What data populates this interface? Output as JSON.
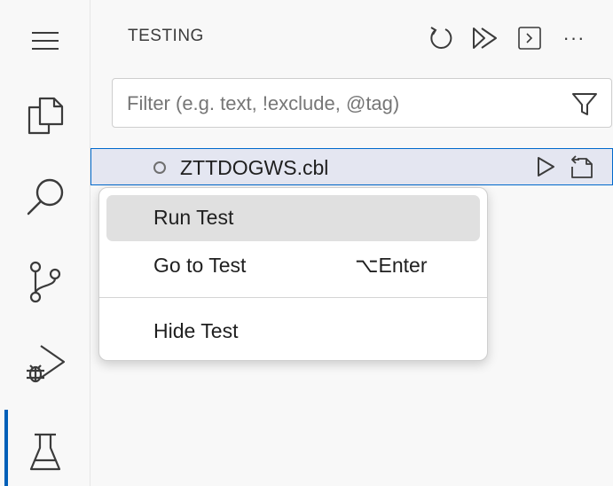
{
  "activity_bar": {
    "icons": [
      "menu-icon",
      "explorer-icon",
      "search-icon",
      "source-control-icon",
      "run-debug-icon",
      "testing-icon"
    ],
    "active": "testing-icon"
  },
  "sidebar": {
    "title": "TESTING",
    "header_actions": [
      "refresh-icon",
      "run-all-icon",
      "terminal-icon",
      "more-icon"
    ],
    "more_label": "···",
    "filter": {
      "placeholder": "Filter (e.g. text, !exclude, @tag)",
      "value": ""
    },
    "tree": {
      "items": [
        {
          "label": "ZTTDOGWS.cbl",
          "status": "unrun"
        }
      ]
    }
  },
  "context_menu": {
    "items": [
      {
        "label": "Run Test",
        "shortcut": ""
      },
      {
        "label": "Go to Test",
        "shortcut": "⌥Enter"
      },
      {
        "label": "Hide Test",
        "shortcut": ""
      }
    ]
  },
  "colors": {
    "accent": "#005fb8",
    "selection_bg": "#e4e6f1",
    "selection_border": "#0069cc",
    "menu_highlight": "#e0e0e0",
    "icon": "#3b3b3b"
  }
}
